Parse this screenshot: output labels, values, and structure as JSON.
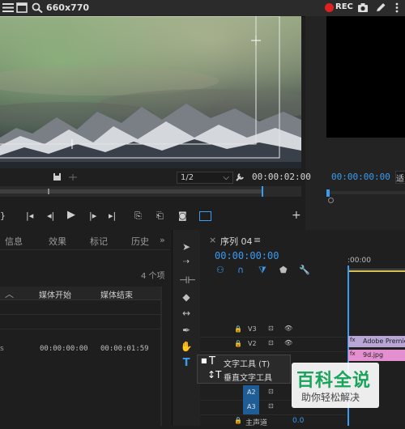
{
  "capture_bar": {
    "title": "660x770",
    "rec_label": "REC"
  },
  "program_monitor": {
    "fit_value": "1/2",
    "timecode": "00:00:02:00"
  },
  "reference_monitor": {
    "timecode": "00:00:00:00",
    "side_char": "适"
  },
  "project_panel": {
    "tabs": [
      "信息",
      "效果",
      "标记",
      "历史"
    ],
    "item_count": "4 个项",
    "columns": [
      "媒体开始",
      "媒体结束"
    ],
    "row": {
      "start": "00:00:00:00",
      "end": "00:00:01:59"
    }
  },
  "sequence": {
    "tab": "序列 04",
    "timecode": "00:00:00:00",
    "ruler_start": ":00:00",
    "tracks": [
      "V3",
      "V2",
      "A2",
      "A3"
    ],
    "master": "主声道",
    "master_value": "0.0",
    "clips": [
      {
        "label": "Adobe Premiere",
        "color": "#b9a6d6"
      },
      {
        "label": "9d.jpg",
        "color": "#e48fd0"
      }
    ]
  },
  "tool_popup": {
    "items": [
      {
        "label": "文字工具 (T)"
      },
      {
        "label": "垂直文字工具"
      }
    ]
  },
  "watermark": {
    "brand": "百科全说",
    "tagline": "助你轻松解决"
  },
  "colors": {
    "accent": "#3b9bf0",
    "rec": "#e02020",
    "brand": "#18a45a"
  }
}
